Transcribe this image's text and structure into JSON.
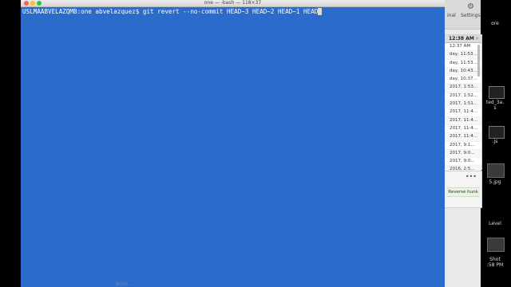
{
  "terminal": {
    "title": "one — -bash — 118×37",
    "prompt": "USLMAABVELAZQMB:one abvelazquez$",
    "command": "git revert --no-commit HEAD~3 HEAD~2 HEAD~1 HEAD"
  },
  "background_app": {
    "toolbar_labels": [
      "inal",
      "Settings"
    ],
    "list_header_time": "12:38 AM",
    "rows": [
      "12:37 AM",
      "day, 11:53...",
      "day, 11:53...",
      "day, 10:43...",
      "day, 10:37...",
      "2017, 1:53...",
      "2017, 1:52...",
      "2017, 1:51...",
      "2017, 11:4...",
      "2017, 11:4...",
      "2017, 11:4...",
      "2017, 11:4...",
      "2017, 9:1...",
      "2017, 9:0...",
      "2017, 9:0...",
      "2016, 2:5...",
      "2016, 2:4...",
      "2016, 1:3..."
    ],
    "hunk_button": "Reverse hunk"
  },
  "desktop": {
    "items": [
      "ore",
      "ted_3a.",
      "s",
      ".js",
      "5.jpg",
      "Level",
      "Shot",
      ":58 PM"
    ]
  },
  "footer_partial": "Activ..."
}
